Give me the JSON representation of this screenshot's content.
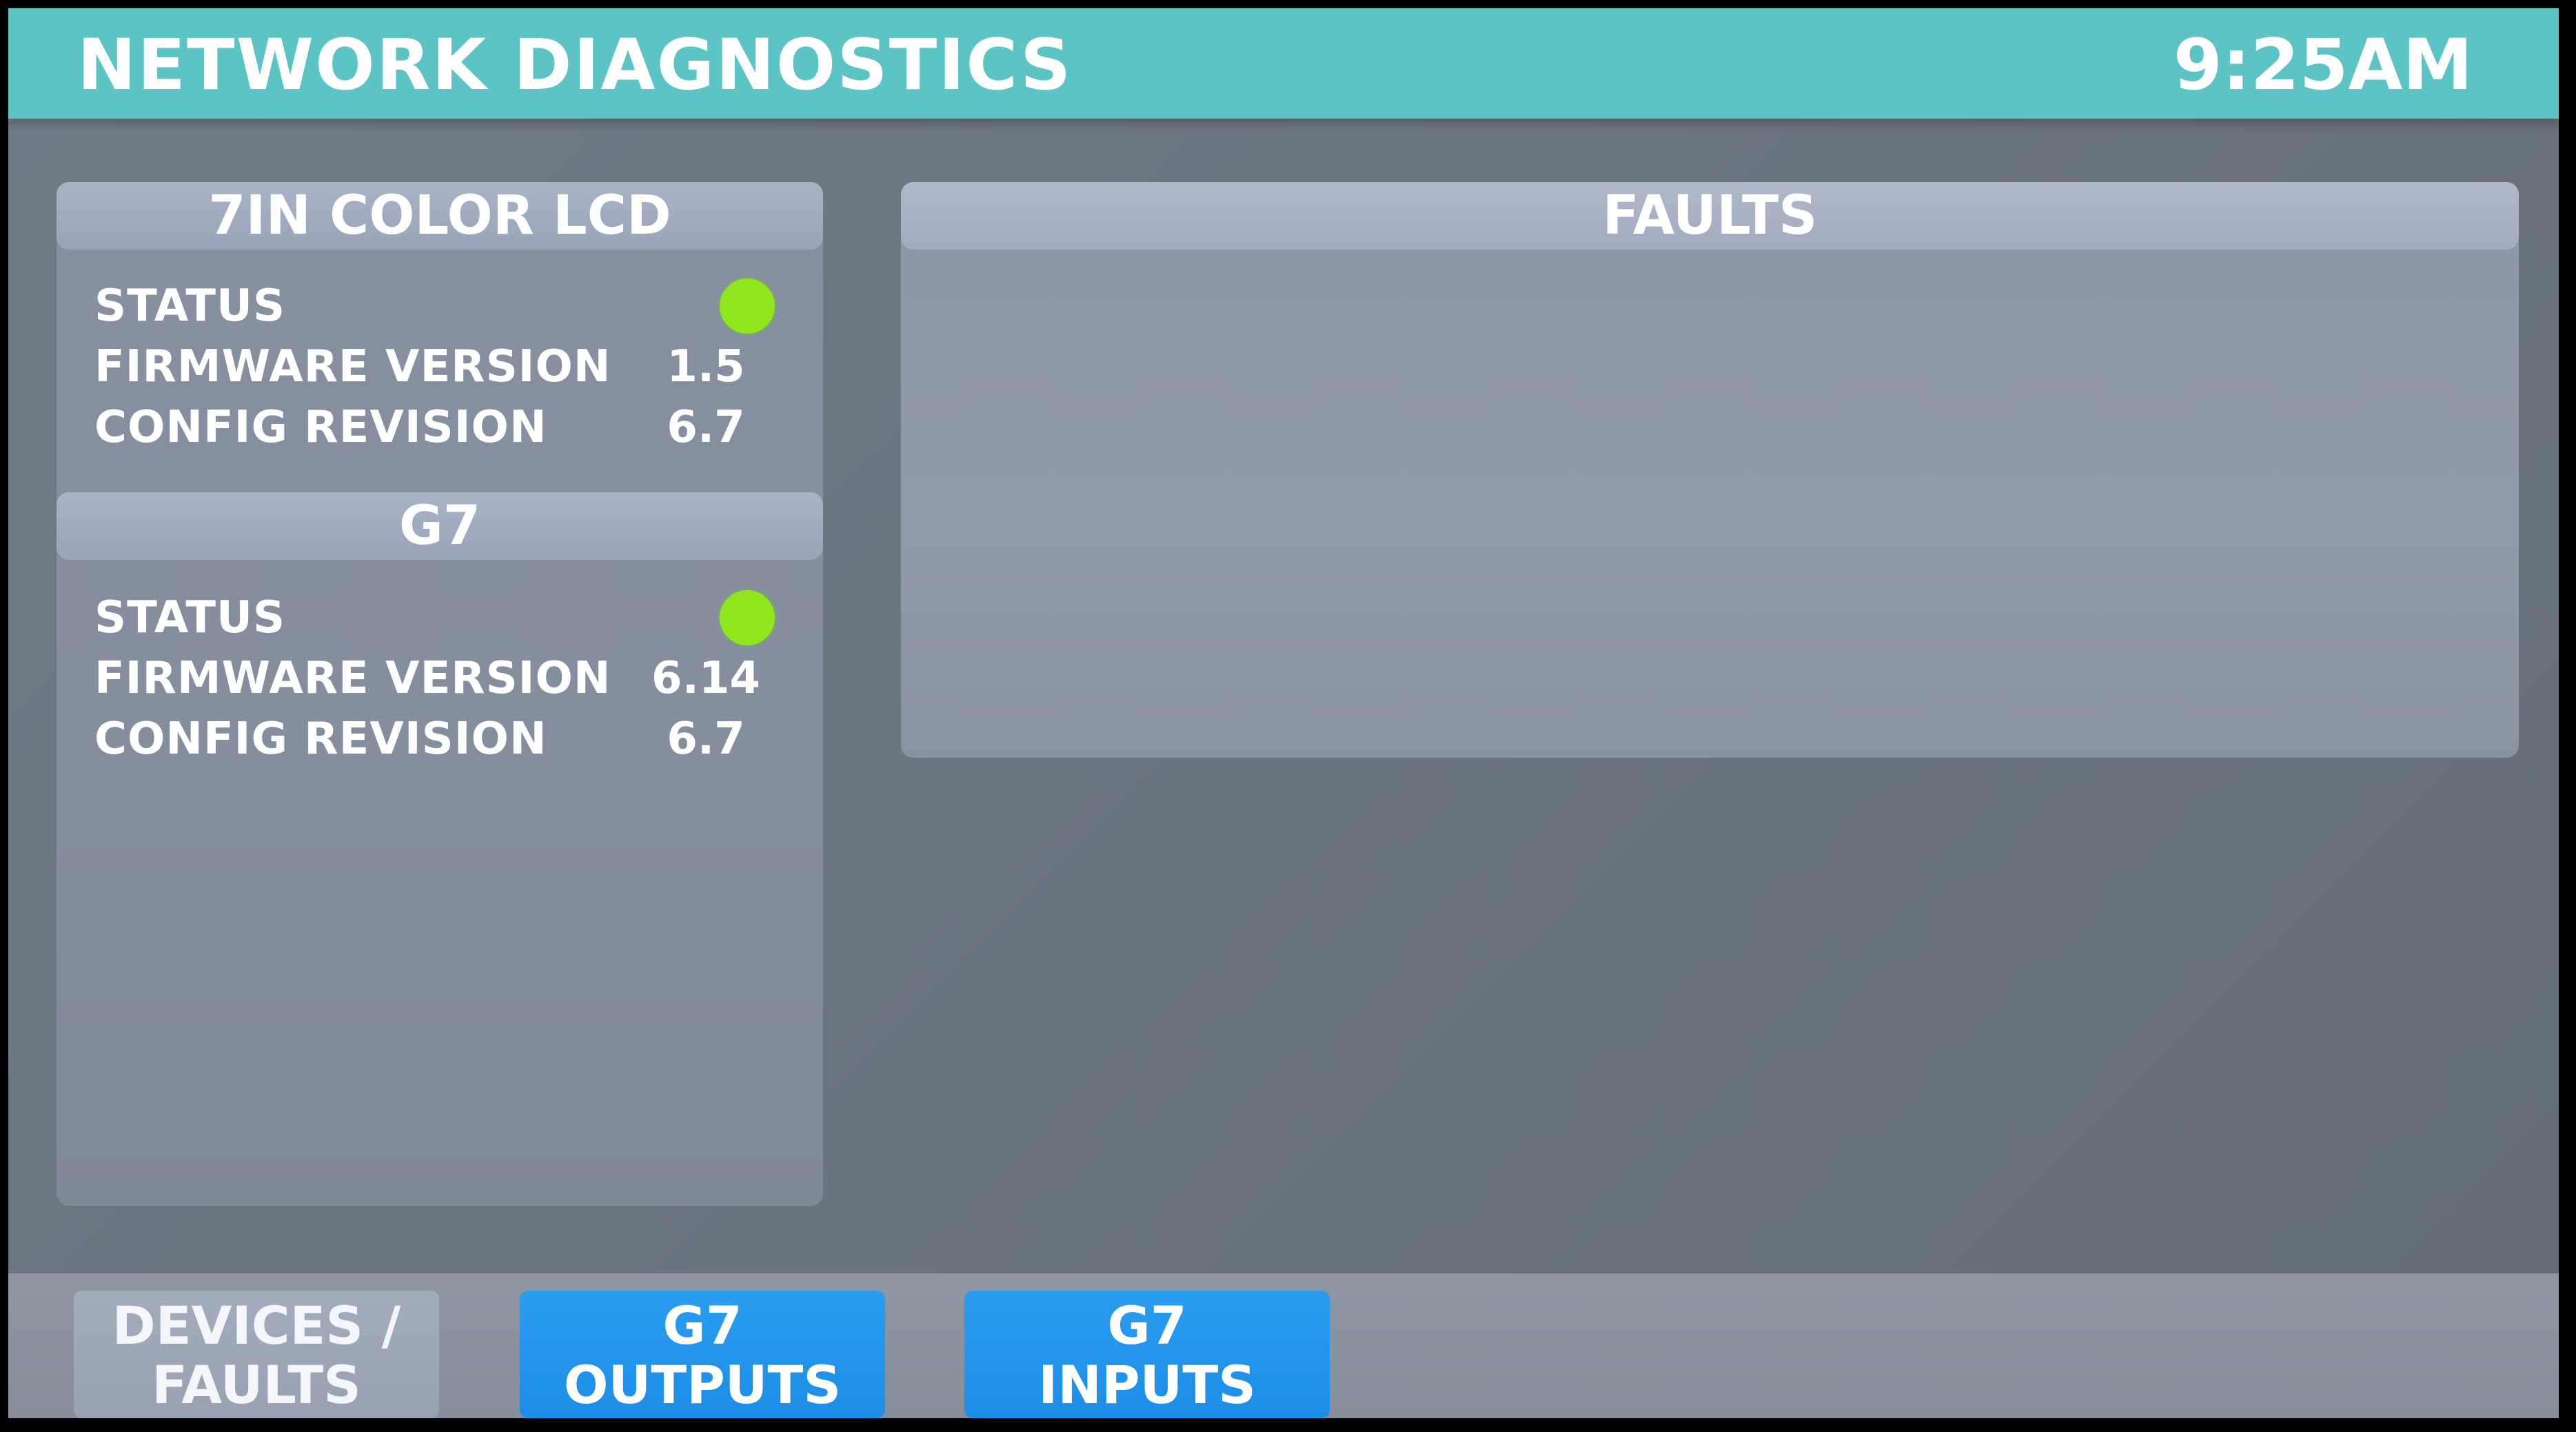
{
  "header": {
    "title": "NETWORK DIAGNOSTICS",
    "time": "9:25AM"
  },
  "devices": [
    {
      "name": "7IN COLOR LCD",
      "status_label": "STATUS",
      "status_color": "#8ee61c",
      "firmware_label": "FIRMWARE VERSION",
      "firmware_value": "1.5",
      "config_label": "CONFIG REVISION",
      "config_value": "6.7"
    },
    {
      "name": "G7",
      "status_label": "STATUS",
      "status_color": "#8ee61c",
      "firmware_label": "FIRMWARE VERSION",
      "firmware_value": "6.14",
      "config_label": "CONFIG REVISION",
      "config_value": "6.7"
    }
  ],
  "faults": {
    "title": "FAULTS"
  },
  "nav": [
    {
      "line1": "DEVICES /",
      "line2": "FAULTS",
      "state": "inactive"
    },
    {
      "line1": "G7",
      "line2": "OUTPUTS",
      "state": "active"
    },
    {
      "line1": "G7",
      "line2": "INPUTS",
      "state": "active"
    }
  ],
  "colors": {
    "title_bar": "#5cc4c4",
    "status_ok": "#8ee61c",
    "nav_active": "#1d8de6",
    "nav_inactive": "#9aa3b4"
  }
}
